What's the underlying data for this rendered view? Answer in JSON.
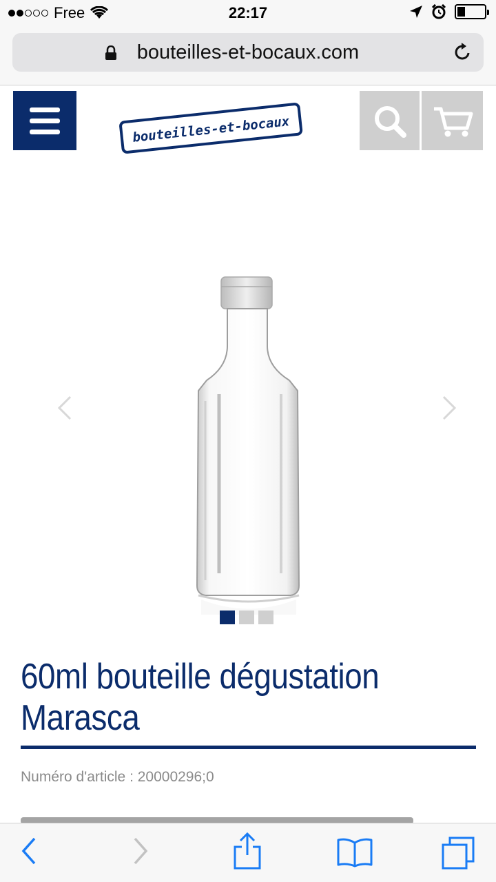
{
  "status_bar": {
    "carrier": "Free",
    "time": "22:17",
    "signal_strength": "2 of 5",
    "battery_level": 0.3
  },
  "browser": {
    "url": "bouteilles-et-bocaux.com"
  },
  "site_header": {
    "logo_text": "bouteilles-et-bocaux",
    "menu_icon": "hamburger-menu-icon",
    "search_icon": "search-icon",
    "cart_icon": "cart-icon"
  },
  "carousel": {
    "slide_count": 3,
    "active_slide": 1,
    "prev_icon": "chevron-left-icon",
    "next_icon": "chevron-right-icon"
  },
  "product": {
    "title": "60ml bouteille dégustation Marasca",
    "article_label": "Numéro d'article : 20000296;0"
  },
  "colors": {
    "brand_navy": "#0b2c6b",
    "button_grey": "#cfcfcf",
    "ios_blue": "#1a7cf5"
  },
  "toolbar": {
    "back_icon": "back-chevron-icon",
    "forward_icon": "forward-chevron-icon",
    "share_icon": "share-icon",
    "bookmarks_icon": "bookmarks-icon",
    "tabs_icon": "tabs-icon"
  }
}
